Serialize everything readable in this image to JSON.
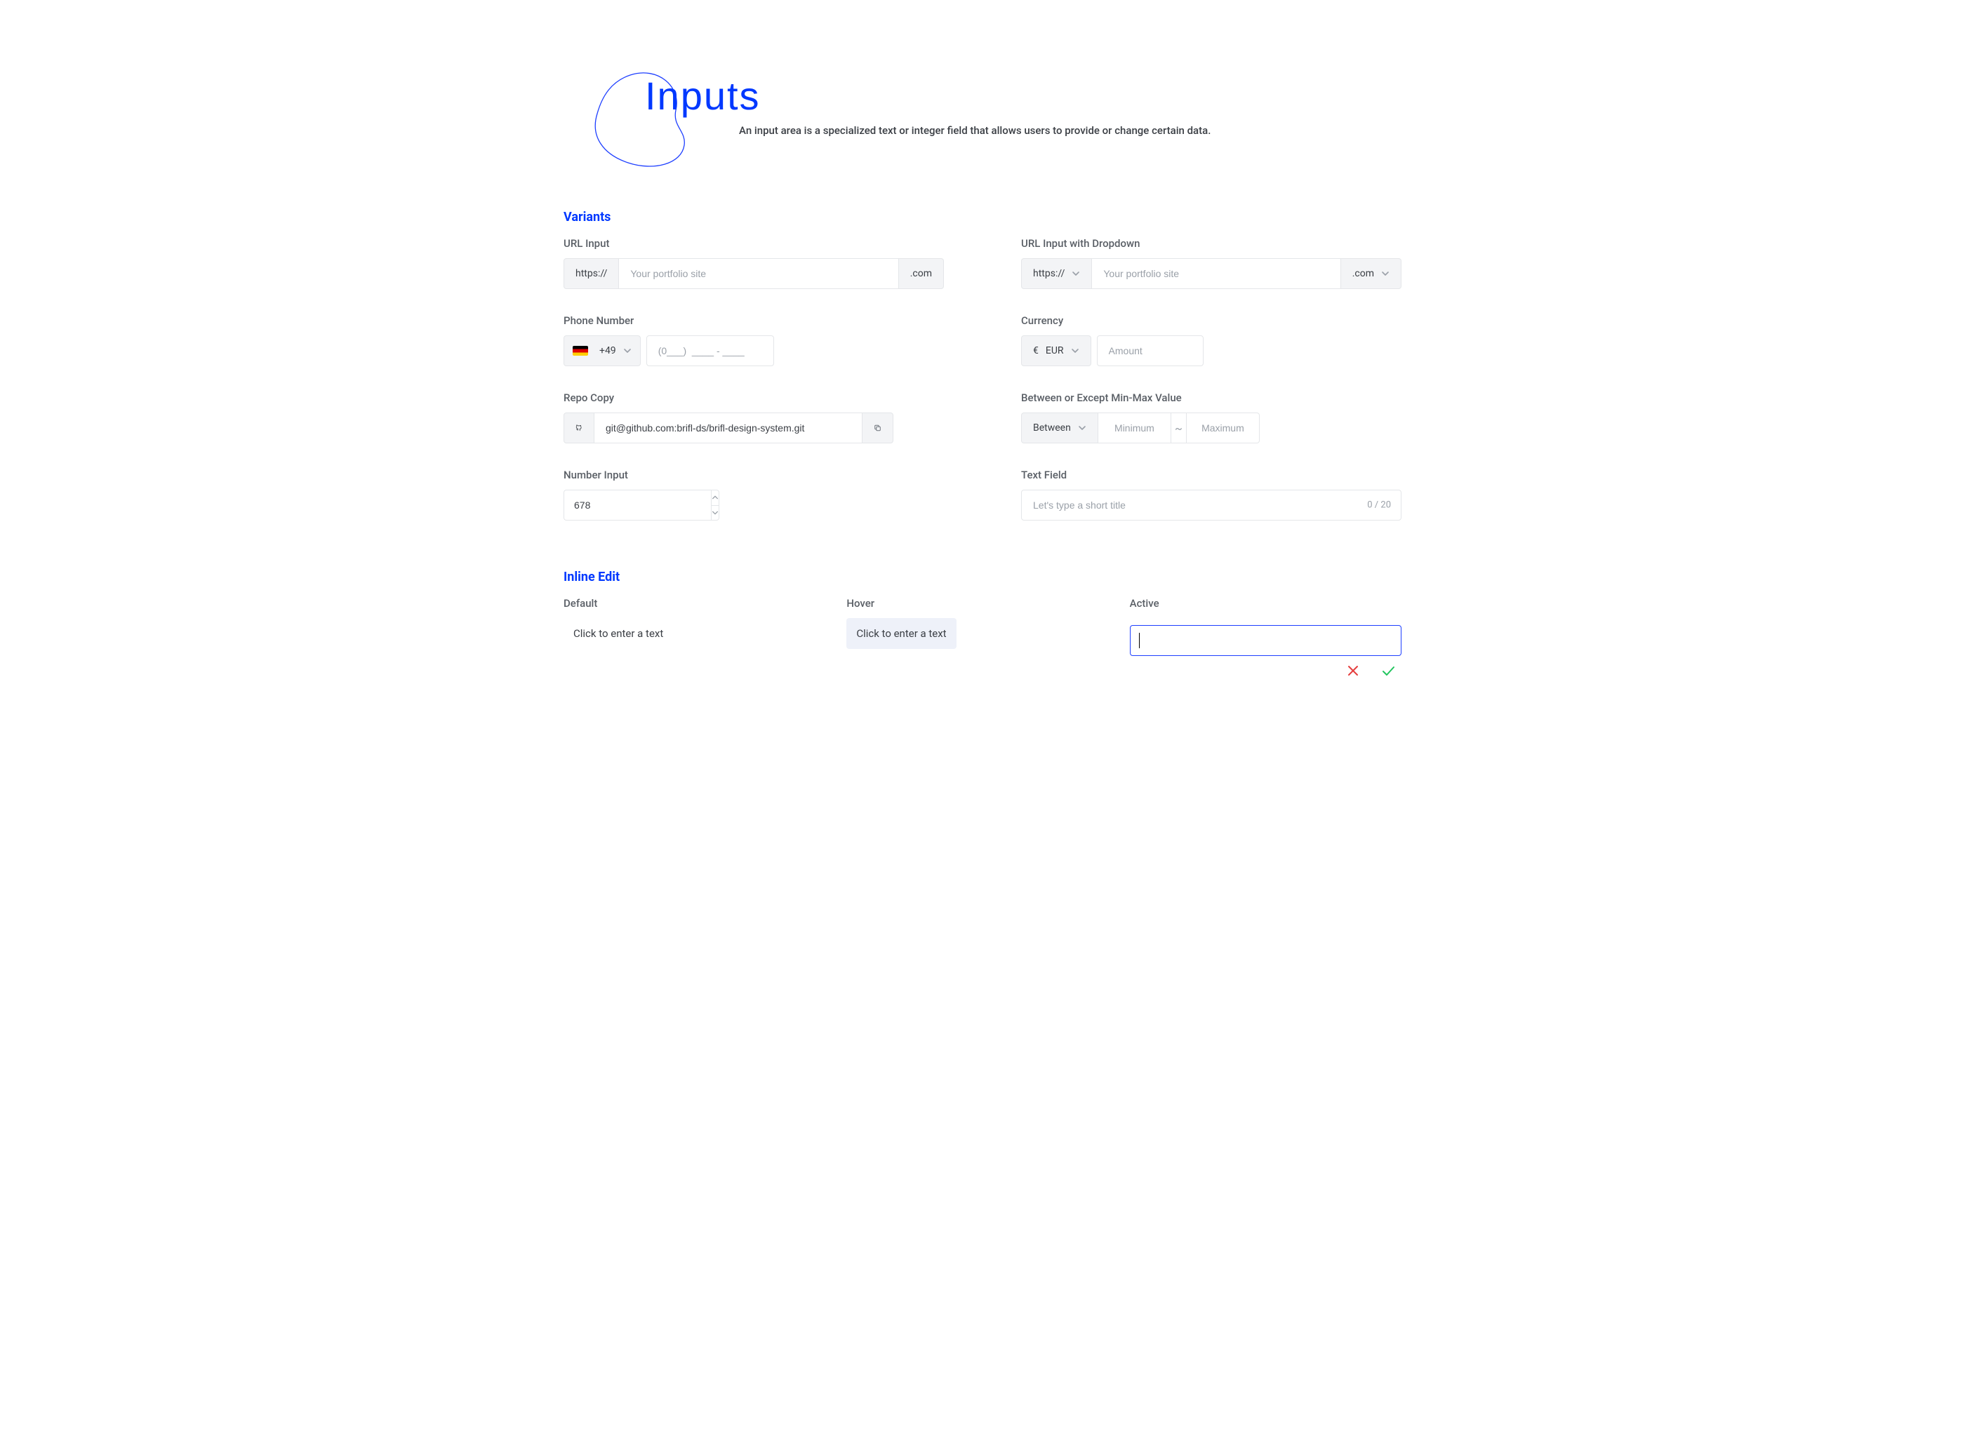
{
  "header": {
    "title": "Inputs",
    "subtitle": "An input area is a specialized text or integer field that allows users to provide or change certain data."
  },
  "sections": {
    "variants": "Variants",
    "inline_edit": "Inline Edit"
  },
  "url_input": {
    "label": "URL Input",
    "prefix": "https://",
    "placeholder": "Your portfolio site",
    "suffix": ".com"
  },
  "url_dropdown": {
    "label": "URL Input with Dropdown",
    "prefix": "https://",
    "placeholder": "Your portfolio site",
    "suffix": ".com"
  },
  "phone": {
    "label": "Phone Number",
    "country_code": "+49",
    "flag": "de",
    "placeholder": "(0___)  ____ - ____"
  },
  "currency": {
    "label": "Currency",
    "symbol": "€",
    "code": "EUR",
    "placeholder": "Amount"
  },
  "repo": {
    "label": "Repo Copy",
    "value": "git@github.com:brifl-ds/brifl-design-system.git"
  },
  "minmax": {
    "label": "Between or Except Min-Max Value",
    "mode": "Between",
    "min_placeholder": "Minimum",
    "separator": "~",
    "max_placeholder": "Maximum"
  },
  "number": {
    "label": "Number Input",
    "value": "678"
  },
  "textfield": {
    "label": "Text Field",
    "placeholder": "Let's type a short title",
    "count": "0 / 20"
  },
  "inline": {
    "default_label": "Default",
    "hover_label": "Hover",
    "active_label": "Active",
    "placeholder": "Click to enter a text"
  }
}
